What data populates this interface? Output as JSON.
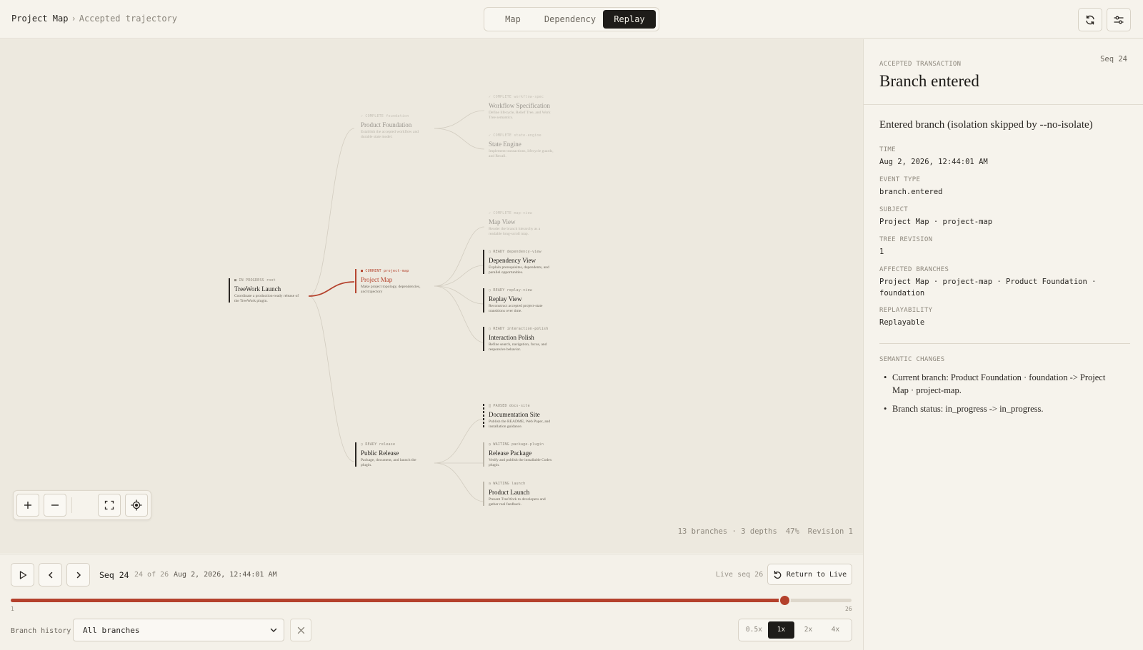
{
  "breadcrumb": {
    "root": "Project Map",
    "separator": "›",
    "current": "Accepted trajectory"
  },
  "view_tabs": [
    {
      "label": "Map",
      "active": false
    },
    {
      "label": "Dependency",
      "active": false
    },
    {
      "label": "Replay",
      "active": true
    }
  ],
  "toolbar": {
    "refresh_icon": "refresh-icon",
    "settings_icon": "sliders-icon"
  },
  "map": {
    "nodes": {
      "root": {
        "meta": "■ IN PROGRESS  root",
        "title": "TreeWork Launch",
        "desc": "Coordinate a production-ready release of the TreeWork plugin."
      },
      "foundation": {
        "meta": "✓ COMPLETE  foundation",
        "title": "Product Foundation",
        "desc": "Establish the accepted workflow and durable state model."
      },
      "workflow": {
        "meta": "✓ COMPLETE  workflow-spec",
        "title": "Workflow Specification",
        "desc": "Define lifecycle, Relief Tree, and Work Tree semantics."
      },
      "state_engine": {
        "meta": "✓ COMPLETE  state-engine",
        "title": "State Engine",
        "desc": "Implement transactions, lifecycle guards, and Recall."
      },
      "project_map": {
        "meta": "■ CURRENT  project-map",
        "title": "Project Map",
        "desc": "Make project topology, dependencies, and trajectory"
      },
      "map_view": {
        "meta": "✓ COMPLETE  map-view",
        "title": "Map View",
        "desc": "Render the branch hierarchy as a readable long-scroll map."
      },
      "dependency_view": {
        "meta": "○ READY  dependency-view",
        "title": "Dependency View",
        "desc": "Explain prerequisites, dependents, and parallel opportunities."
      },
      "replay_view": {
        "meta": "○ READY  replay-view",
        "title": "Replay View",
        "desc": "Reconstruct accepted project-state transitions over time."
      },
      "interaction": {
        "meta": "○ READY  interaction-polish",
        "title": "Interaction Polish",
        "desc": "Refine search, navigation, focus, and responsive behavior."
      },
      "release": {
        "meta": "○ READY  release",
        "title": "Public Release",
        "desc": "Package, document, and launch the plugin."
      },
      "docs": {
        "meta": "‖ PAUSED  docs-site",
        "title": "Documentation Site",
        "desc": "Publish the README, Web Paper, and installation guidance."
      },
      "package": {
        "meta": "◷ WAITING  package-plugin",
        "title": "Release Package",
        "desc": "Verify and publish the installable Codex plugin."
      },
      "launch": {
        "meta": "◷ WAITING  launch",
        "title": "Product Launch",
        "desc": "Present TreeWork to developers and gather real feedback."
      }
    },
    "stats": {
      "branches": "13 branches",
      "depths": "3 depths",
      "zoom": "47%",
      "revision": "Revision 1"
    },
    "zoom_controls": [
      "zoom-in-icon",
      "zoom-out-icon",
      "fit-view-icon",
      "locate-icon"
    ]
  },
  "replay": {
    "seq_label": "Seq 24",
    "seq_of": "24 of 26",
    "seq_time": "Aug 2, 2026, 12:44:01 AM",
    "live_seq": "Live seq 26",
    "return_live": "Return to Live",
    "slider": {
      "min": 1,
      "max": 26,
      "value": 24,
      "min_label": "1",
      "max_label": "26"
    },
    "branch_history_label": "Branch history",
    "branch_history_value": "All branches",
    "speeds": [
      {
        "label": "0.5x",
        "active": false
      },
      {
        "label": "1x",
        "active": true
      },
      {
        "label": "2x",
        "active": false
      },
      {
        "label": "4x",
        "active": false
      }
    ],
    "accent_color": "#b4412c"
  },
  "details": {
    "eyebrow": "ACCEPTED TRANSACTION",
    "seq": "Seq 24",
    "title": "Branch entered",
    "summary": "Entered branch (isolation skipped by --no-isolate)",
    "fields": {
      "time": {
        "label": "TIME",
        "value": "Aug 2, 2026, 12:44:01 AM"
      },
      "event_type": {
        "label": "EVENT TYPE",
        "value": "branch.entered"
      },
      "subject": {
        "label": "SUBJECT",
        "value": "Project Map · project-map"
      },
      "tree_revision": {
        "label": "TREE REVISION",
        "value": "1"
      },
      "affected": {
        "label": "AFFECTED BRANCHES",
        "value": "Project Map · project-map · Product Foundation · foundation"
      },
      "replayability": {
        "label": "REPLAYABILITY",
        "value": "Replayable"
      }
    },
    "semantic_changes_label": "SEMANTIC CHANGES",
    "semantic_changes": [
      "Current branch: Product Foundation · foundation -> Project Map · project-map.",
      "Branch status: in_progress -> in_progress."
    ]
  }
}
